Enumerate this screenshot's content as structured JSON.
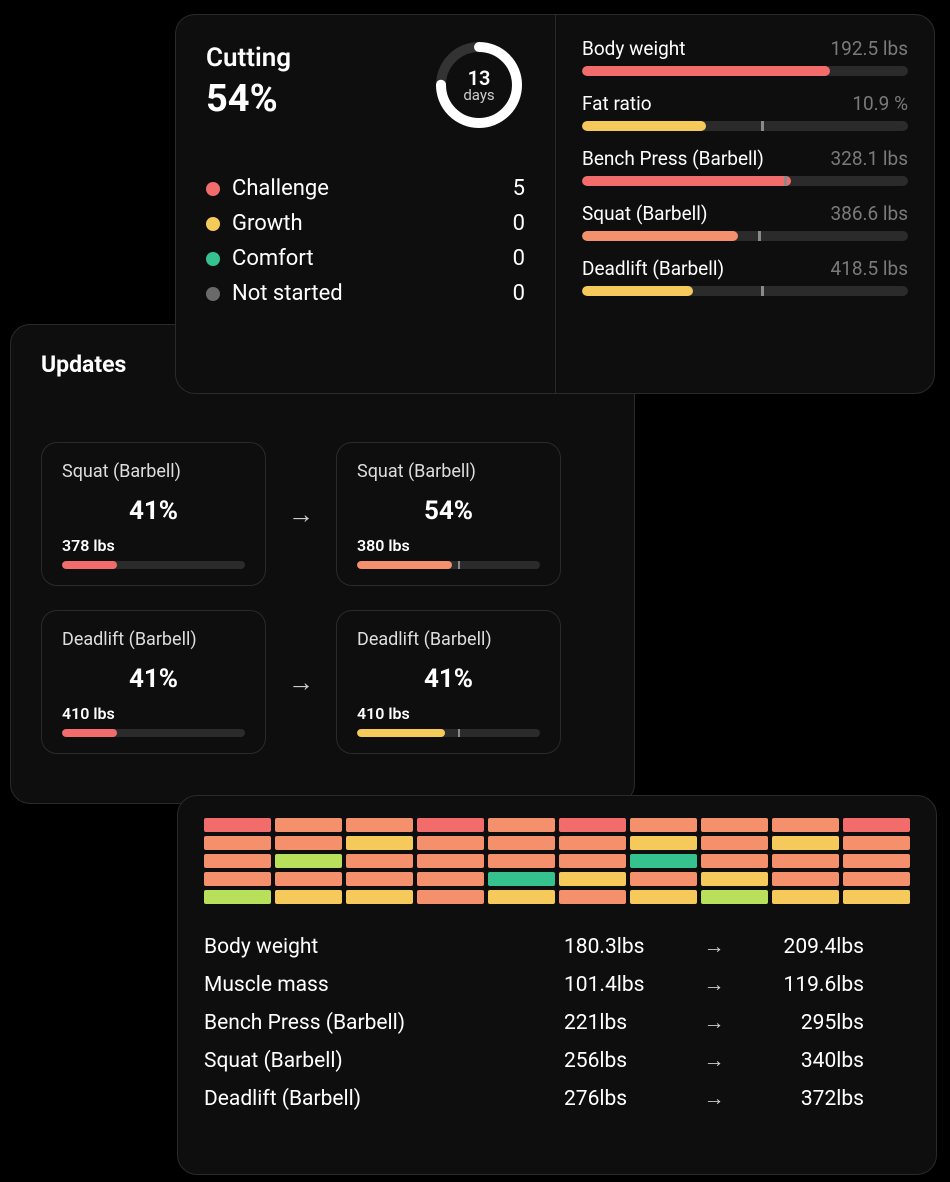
{
  "colors": {
    "challenge": "#f36c6c",
    "growth": "#f5c95a",
    "comfort": "#35c28f",
    "notstarted": "#6a6a6a",
    "orange": "#f4906c",
    "lime": "#b8e05a"
  },
  "summary": {
    "title": "Cutting",
    "percent": "54%",
    "ring": {
      "number": "13",
      "unit": "days",
      "progress": 0.75
    },
    "legend": [
      {
        "label": "Challenge",
        "count": "5",
        "colorKey": "challenge"
      },
      {
        "label": "Growth",
        "count": "0",
        "colorKey": "growth"
      },
      {
        "label": "Comfort",
        "count": "0",
        "colorKey": "comfort"
      },
      {
        "label": "Not started",
        "count": "0",
        "colorKey": "notstarted"
      }
    ],
    "metrics": [
      {
        "name": "Body weight",
        "value": "192.5 lbs",
        "fill": 0.76,
        "tick": null,
        "colorClass": "c-red"
      },
      {
        "name": "Fat ratio",
        "value": "10.9 %",
        "fill": 0.38,
        "tick": 0.55,
        "colorClass": "c-yellow"
      },
      {
        "name": "Bench Press (Barbell)",
        "value": "328.1 lbs",
        "fill": 0.64,
        "tick": 0.62,
        "colorClass": "c-red"
      },
      {
        "name": "Squat (Barbell)",
        "value": "386.6 lbs",
        "fill": 0.48,
        "tick": 0.54,
        "colorClass": "c-orange"
      },
      {
        "name": "Deadlift (Barbell)",
        "value": "418.5 lbs",
        "fill": 0.34,
        "tick": 0.55,
        "colorClass": "c-yellow"
      }
    ]
  },
  "updates": {
    "title": "Updates",
    "rows": [
      {
        "before": {
          "name": "Squat (Barbell)",
          "pct": "41%",
          "value": "378 lbs",
          "fill": 0.3,
          "tick": null,
          "colorClass": "c-red"
        },
        "after": {
          "name": "Squat (Barbell)",
          "pct": "54%",
          "value": "380 lbs",
          "fill": 0.52,
          "tick": 0.55,
          "colorClass": "c-orange"
        }
      },
      {
        "before": {
          "name": "Deadlift (Barbell)",
          "pct": "41%",
          "value": "410 lbs",
          "fill": 0.3,
          "tick": null,
          "colorClass": "c-red"
        },
        "after": {
          "name": "Deadlift (Barbell)",
          "pct": "41%",
          "value": "410 lbs",
          "fill": 0.48,
          "tick": 0.55,
          "colorClass": "c-yellow"
        }
      }
    ]
  },
  "history": {
    "heatmap": [
      [
        "c-red",
        "c-orange",
        "c-orange",
        "c-red",
        "c-orange",
        "c-red",
        "c-orange",
        "c-orange",
        "c-orange",
        "c-red"
      ],
      [
        "c-orange",
        "c-orange",
        "c-yellow",
        "c-orange",
        "c-orange",
        "c-orange",
        "c-yellow",
        "c-orange",
        "c-yellow",
        "c-orange"
      ],
      [
        "c-orange",
        "c-lime",
        "c-orange",
        "c-orange",
        "c-orange",
        "c-orange",
        "c-green",
        "c-orange",
        "c-orange",
        "c-orange"
      ],
      [
        "c-orange",
        "c-orange",
        "c-orange",
        "c-orange",
        "c-green",
        "c-yellow",
        "c-orange",
        "c-yellow",
        "c-orange",
        "c-orange"
      ],
      [
        "c-lime",
        "c-yellow",
        "c-yellow",
        "c-orange",
        "c-yellow",
        "c-orange",
        "c-yellow",
        "c-lime",
        "c-yellow",
        "c-yellow"
      ]
    ],
    "stats": [
      {
        "name": "Body weight",
        "from": "180.3lbs",
        "to": "209.4lbs"
      },
      {
        "name": "Muscle mass",
        "from": "101.4lbs",
        "to": "119.6lbs"
      },
      {
        "name": "Bench Press (Barbell)",
        "from": "221lbs",
        "to": "295lbs"
      },
      {
        "name": "Squat (Barbell)",
        "from": "256lbs",
        "to": "340lbs"
      },
      {
        "name": "Deadlift (Barbell)",
        "from": "276lbs",
        "to": "372lbs"
      }
    ]
  },
  "glyphs": {
    "arrow": "→"
  }
}
